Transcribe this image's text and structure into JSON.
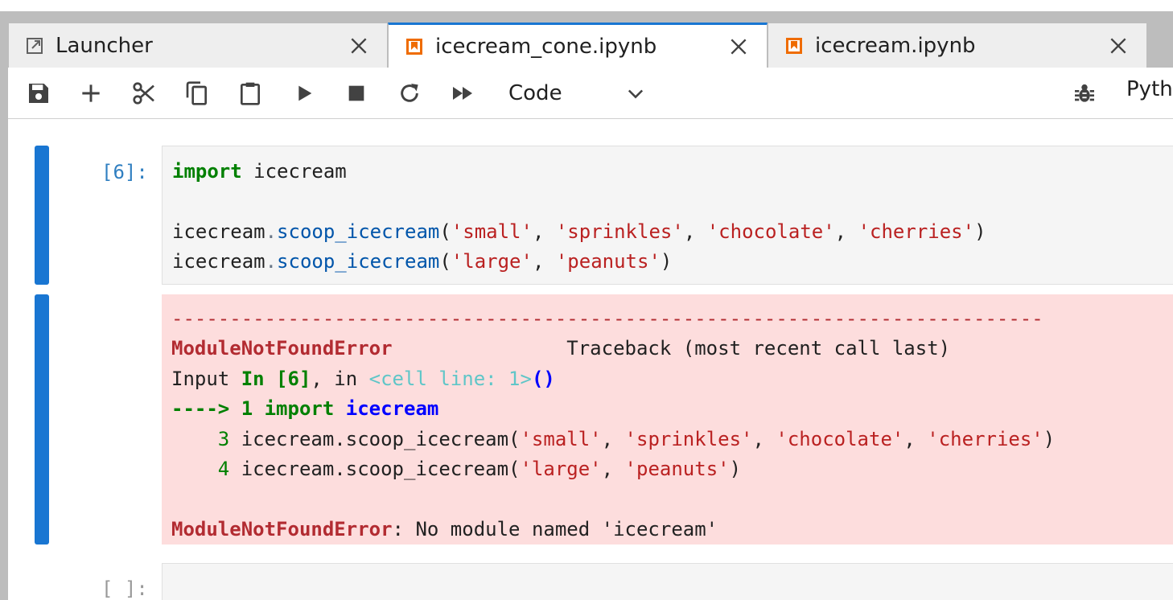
{
  "tabs": [
    {
      "label": "Launcher",
      "icon": "launcher-icon"
    },
    {
      "label": "icecream_cone.ipynb",
      "icon": "notebook-icon",
      "active": true
    },
    {
      "label": "icecream.ipynb",
      "icon": "notebook-icon"
    }
  ],
  "toolbar": {
    "cell_type": "Code",
    "kernel_name": "Pyth",
    "icons": [
      "save-icon",
      "add-icon",
      "cut-icon",
      "copy-icon",
      "paste-icon",
      "run-icon",
      "stop-icon",
      "restart-icon",
      "fast-forward-icon",
      "chevron-down-icon",
      "debug-bug-icon"
    ]
  },
  "cells": [
    {
      "prompt": "[6]:",
      "code": {
        "l1_kw": "import",
        "l1_rest": " icecream",
        "l3_obj": "icecream",
        "l3_dot": ".",
        "l3_fn": "scoop_icecream",
        "l3_open": "(",
        "l3_a1": "'small'",
        "l3_c1": ", ",
        "l3_a2": "'sprinkles'",
        "l3_c2": ", ",
        "l3_a3": "'chocolate'",
        "l3_c3": ", ",
        "l3_a4": "'cherries'",
        "l3_close": ")",
        "l4_obj": "icecream",
        "l4_dot": ".",
        "l4_fn": "scoop_icecream",
        "l4_open": "(",
        "l4_a1": "'large'",
        "l4_c1": ", ",
        "l4_a2": "'peanuts'",
        "l4_close": ")"
      },
      "output": {
        "dashes": "---------------------------------------------------------------------------",
        "error_name": "ModuleNotFoundError",
        "traceback_label": "Traceback (most recent call last)",
        "input_word": "Input ",
        "in_label": "In [6]",
        "in_sep": ", in ",
        "cell_line": "<cell line: 1>",
        "parens": "()",
        "arrow_line": "----> 1 ",
        "arrow_import": "import",
        "arrow_space": " ",
        "arrow_mod": "icecream",
        "line3_num": "3",
        "line3_obj": " icecream.scoop_icecream(",
        "line3_a1": "'small'",
        "line3_c1": ", ",
        "line3_a2": "'sprinkles'",
        "line3_c2": ", ",
        "line3_a3": "'chocolate'",
        "line3_c3": ", ",
        "line3_a4": "'cherries'",
        "line3_close": ")",
        "line4_num": "4",
        "line4_obj": " icecream.scoop_icecream(",
        "line4_a1": "'large'",
        "line4_c1": ", ",
        "line4_a2": "'peanuts'",
        "line4_close": ")",
        "final_error": "ModuleNotFoundError",
        "final_msg": ": No module named 'icecream'"
      }
    },
    {
      "prompt": "[ ]:"
    }
  ]
}
